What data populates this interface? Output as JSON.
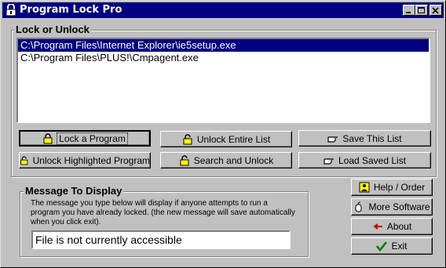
{
  "window": {
    "title": "Program Lock Pro"
  },
  "lock_group": {
    "label": "Lock or Unlock"
  },
  "list": {
    "items": [
      {
        "path": "C:\\Program Files\\Internet Explorer\\ie5setup.exe",
        "selected": true
      },
      {
        "path": "C:\\Program Files\\PLUS!\\Cmpagent.exe",
        "selected": false
      }
    ]
  },
  "buttons": {
    "lock": "Lock a Program",
    "unlock_entire": "Unlock Entire List",
    "save_list": "Save This List",
    "unlock_highlighted": "Unlock Highlighted Program",
    "search_unlock": "Search and Unlock",
    "load_list": "Load Saved List",
    "help": "Help / Order",
    "more_software": "More Software",
    "about": "About",
    "exit": "Exit"
  },
  "message_group": {
    "label": "Message To Display",
    "description": "The message you type below will display if anyone attempts to run a program you have already locked. (the new message will save automatically when you click exit).",
    "value": "File is not currently accessible"
  },
  "colors": {
    "titlebar": "#000080",
    "face": "#c0c0c0",
    "selection": "#000080"
  }
}
